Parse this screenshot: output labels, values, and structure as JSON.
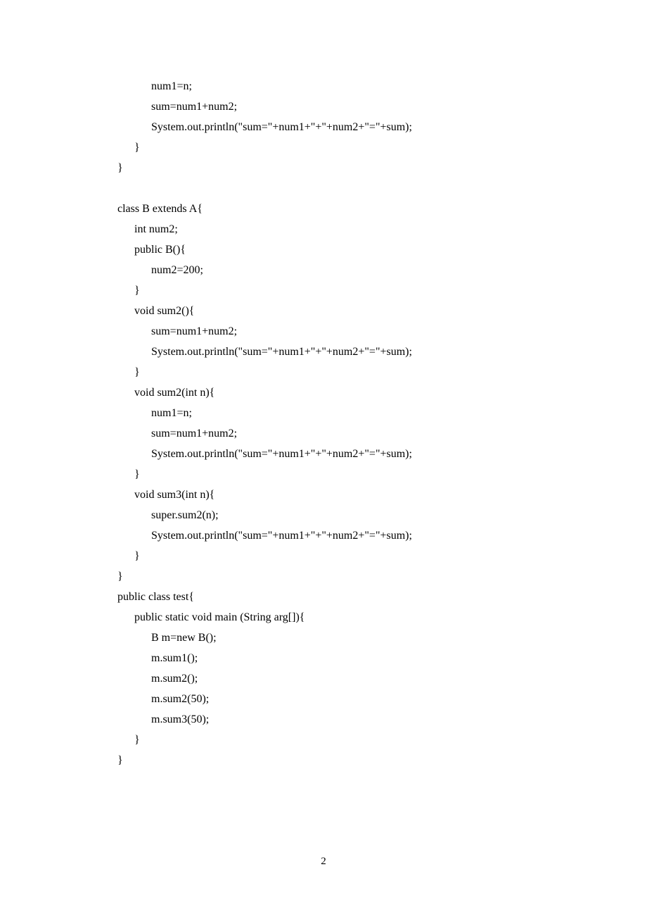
{
  "lines": [
    "            num1=n;",
    "            sum=num1+num2;",
    "            System.out.println(\"sum=\"+num1+\"+\"+num2+\"=\"+sum);",
    "      }",
    "}",
    "",
    "class B extends A{",
    "      int num2;",
    "      public B(){",
    "            num2=200;",
    "      }",
    "      void sum2(){",
    "            sum=num1+num2;",
    "            System.out.println(\"sum=\"+num1+\"+\"+num2+\"=\"+sum);",
    "      }",
    "      void sum2(int n){",
    "            num1=n;",
    "            sum=num1+num2;",
    "            System.out.println(\"sum=\"+num1+\"+\"+num2+\"=\"+sum);",
    "      }",
    "      void sum3(int n){",
    "            super.sum2(n);",
    "            System.out.println(\"sum=\"+num1+\"+\"+num2+\"=\"+sum);",
    "      }",
    "}",
    "public class test{",
    "      public static void main (String arg[]){",
    "            B m=new B();",
    "            m.sum1();",
    "            m.sum2();",
    "            m.sum2(50);",
    "            m.sum3(50);",
    "      }",
    "}"
  ],
  "pageNumber": "2"
}
